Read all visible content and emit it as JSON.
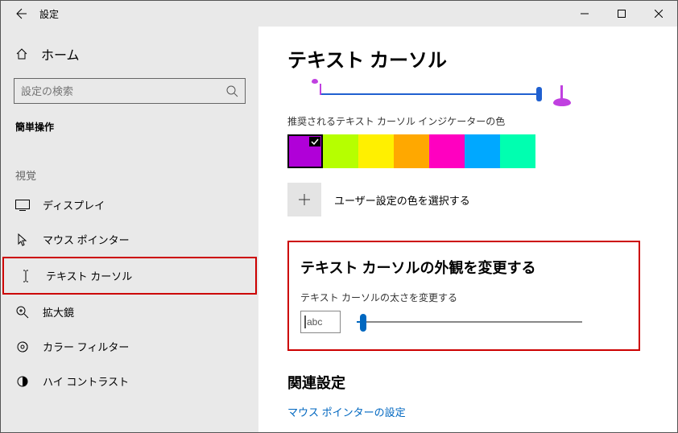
{
  "titlebar": {
    "title": "設定"
  },
  "sidebar": {
    "home": "ホーム",
    "searchPlaceholder": "設定の検索",
    "category": "簡単操作",
    "sectionVision": "視覚",
    "items": [
      {
        "label": "ディスプレイ"
      },
      {
        "label": "マウス ポインター"
      },
      {
        "label": "テキスト カーソル"
      },
      {
        "label": "拡大鏡"
      },
      {
        "label": "カラー フィルター"
      },
      {
        "label": "ハイ コントラスト"
      }
    ]
  },
  "page": {
    "title": "テキスト カーソル",
    "recommendedLabel": "推奨されるテキスト カーソル インジケーターの色",
    "swatches": [
      "#b000d8",
      "#b6ff00",
      "#fff000",
      "#ffa800",
      "#ff00c0",
      "#00a8ff",
      "#00ffb0"
    ],
    "selectedSwatch": 0,
    "customColorLabel": "ユーザー設定の色を選択する",
    "appearanceTitle": "テキスト カーソルの外観を変更する",
    "thicknessLabel": "テキスト カーソルの太さを変更する",
    "previewText": "abc",
    "relatedTitle": "関連設定",
    "relatedLink": "マウス ポインターの設定"
  }
}
